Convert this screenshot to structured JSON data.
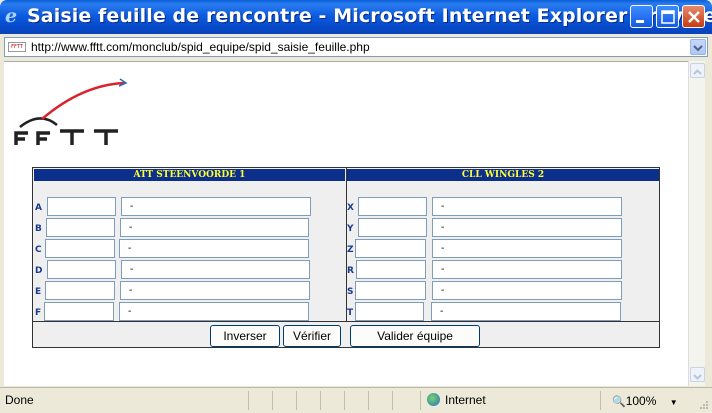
{
  "window": {
    "title": "Saisie feuille de rencontre - Microsoft Internet Explorer provide...",
    "address": "http://www.fftt.com/monclub/spid_equipe/spid_saisie_feuille.php"
  },
  "logo": {
    "text": "FFTT",
    "favicon_text": "FFTT"
  },
  "home_team": {
    "name": "ATT STEENVOORDE 1",
    "rows": [
      {
        "letter": "A",
        "license": "",
        "player": "-"
      },
      {
        "letter": "B",
        "license": "",
        "player": "-"
      },
      {
        "letter": "C",
        "license": "",
        "player": "-"
      },
      {
        "letter": "D",
        "license": "",
        "player": "-"
      },
      {
        "letter": "E",
        "license": "",
        "player": "-"
      },
      {
        "letter": "F",
        "license": "",
        "player": "-"
      }
    ]
  },
  "away_team": {
    "name": "CLL WINGLES 2",
    "rows": [
      {
        "letter": "X",
        "license": "",
        "player": "-"
      },
      {
        "letter": "Y",
        "license": "",
        "player": "-"
      },
      {
        "letter": "Z",
        "license": "",
        "player": "-"
      },
      {
        "letter": "R",
        "license": "",
        "player": "-"
      },
      {
        "letter": "S",
        "license": "",
        "player": "-"
      },
      {
        "letter": "T",
        "license": "",
        "player": "-"
      }
    ]
  },
  "buttons": {
    "inverser": "Inverser",
    "verifier": "Vérifier",
    "valider": "Valider équipe"
  },
  "status": {
    "text": "Done",
    "zone": "Internet",
    "zoom": "100%"
  },
  "colors": {
    "header_bg": "#0c2f8c",
    "header_text": "#ffff33",
    "row_label": "#1b3a8c"
  }
}
